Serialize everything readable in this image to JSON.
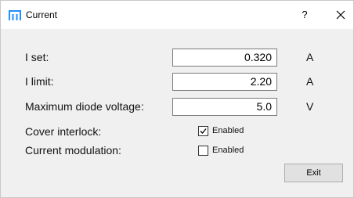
{
  "window": {
    "title": "Current",
    "help_label": "?"
  },
  "form": {
    "i_set": {
      "label": "I set:",
      "value": "0.320",
      "unit": "A"
    },
    "i_limit": {
      "label": "I limit:",
      "value": "2.20",
      "unit": "A"
    },
    "max_diode_voltage": {
      "label": "Maximum diode voltage:",
      "value": "5.0",
      "unit": "V"
    },
    "cover_interlock": {
      "label": "Cover interlock:",
      "checkbox_label": "Enabled",
      "checked": true
    },
    "current_modulation": {
      "label": "Current modulation:",
      "checkbox_label": "Enabled",
      "checked": false
    }
  },
  "buttons": {
    "exit_label": "Exit"
  },
  "icons": {
    "app": "app-icon",
    "close": "close-icon",
    "checkmark": "checkmark-icon"
  },
  "colors": {
    "app_icon": "#1e90ff",
    "window_bg": "#f0f0f0",
    "titlebar_bg": "#ffffff"
  }
}
